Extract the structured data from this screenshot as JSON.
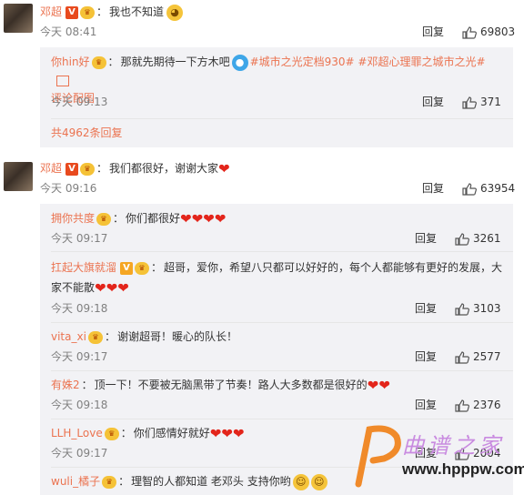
{
  "comments": [
    {
      "user": "邓超",
      "text": "我也不知道",
      "time": "今天 08:41",
      "reply_label": "回复",
      "likes": "69803",
      "replies": [
        {
          "user": "你hin好",
          "text_pre": "那就先期待一下方木吧",
          "tags": "#城市之光定档930# #邓超心理罪之城市之光#",
          "tail": "评论配图",
          "time": "今天 09:13",
          "reply_label": "回复",
          "likes": "371"
        }
      ],
      "more_replies": "共4962条回复"
    },
    {
      "user": "邓超",
      "text": "我们都很好，谢谢大家",
      "time": "今天 09:16",
      "reply_label": "回复",
      "likes": "63954",
      "replies": [
        {
          "user": "拥你共度",
          "text": "你们都很好",
          "time": "今天 09:17",
          "reply_label": "回复",
          "likes": "3261"
        },
        {
          "user": "扛起大旗就溜",
          "text_l1": "超哥，爱你，希望八只都可以好好的，每个人都能够有更好的发展，大",
          "text_l2": "家不能散",
          "time": "今天 09:18",
          "reply_label": "回复",
          "likes": "3103"
        },
        {
          "user": "vita_xi",
          "text": "谢谢超哥！暖心的队长！",
          "time": "今天 09:17",
          "reply_label": "回复",
          "likes": "2577"
        },
        {
          "user": "有姝2",
          "text": "顶一下！不要被无脑黑带了节奏！路人大多数都是很好的",
          "time": "今天 09:18",
          "reply_label": "回复",
          "likes": "2376"
        },
        {
          "user": "LLH_Love",
          "text": "你们感情好就好",
          "time": "今天 09:17",
          "reply_label": "回复",
          "likes": "2004"
        },
        {
          "user": "wuli_橘子",
          "text": "理智的人都知道 老邓头 支持你哟"
        }
      ]
    }
  ],
  "watermark": {
    "title": "曲谱之家",
    "url": "www.hpppw.com"
  },
  "colors": {
    "name": "#eb7350",
    "sub_bg": "#f2f2f5",
    "meta": "#808080",
    "heart": "#e3251b"
  },
  "icons": {
    "like": "thumbs-up-icon",
    "vip": "v-badge-icon",
    "crown": "crown-badge-icon",
    "heart": "red-heart-icon",
    "image": "image-icon"
  }
}
